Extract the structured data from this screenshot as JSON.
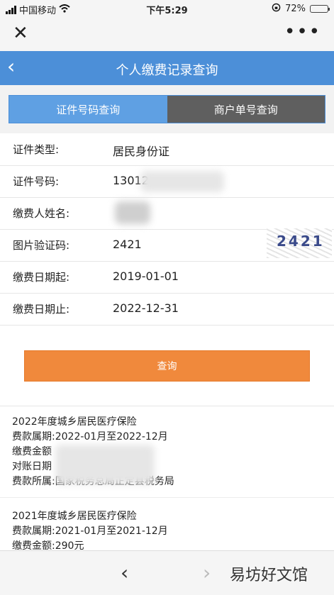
{
  "statusbar": {
    "carrier": "中国移动",
    "time": "下午5:29",
    "battery_text": "72%",
    "battery_level": 0.72
  },
  "wechat": {
    "close_icon": "close-icon",
    "more_icon": "more-icon"
  },
  "header": {
    "title": "个人缴费记录查询"
  },
  "tabs": [
    {
      "label": "证件号码查询",
      "active": true
    },
    {
      "label": "商户单号查询",
      "active": false
    }
  ],
  "form": {
    "id_type": {
      "label": "证件类型:",
      "value": "居民身份证"
    },
    "id_number": {
      "label": "证件号码:",
      "value": "13012"
    },
    "payer_name": {
      "label": "缴费人姓名:",
      "value": ""
    },
    "captcha": {
      "label": "图片验证码:",
      "value": "2421",
      "image_code": "2421"
    },
    "date_start": {
      "label": "缴费日期起:",
      "value": "2019-01-01"
    },
    "date_end": {
      "label": "缴费日期止:",
      "value": "2022-12-31"
    }
  },
  "query_button": "查询",
  "records": [
    {
      "title": "2022年度城乡居民医疗保险",
      "period": "费款属期:2022-01月至2022-12月",
      "amount": "缴费金额",
      "reconcile": "对账日期",
      "office": "费款所属:国家税务总局正定县税务局"
    },
    {
      "title": "2021年度城乡居民医疗保险",
      "period": "费款属期:2021-01月至2021-12月",
      "amount": "缴费金额:290元"
    }
  ],
  "bottom": {
    "watermark": "易坊好文馆"
  },
  "colors": {
    "primary": "#4c8fd8",
    "tab_active": "#5fa0e3",
    "tab_inactive": "#5f5f5f",
    "button": "#f0893c"
  }
}
